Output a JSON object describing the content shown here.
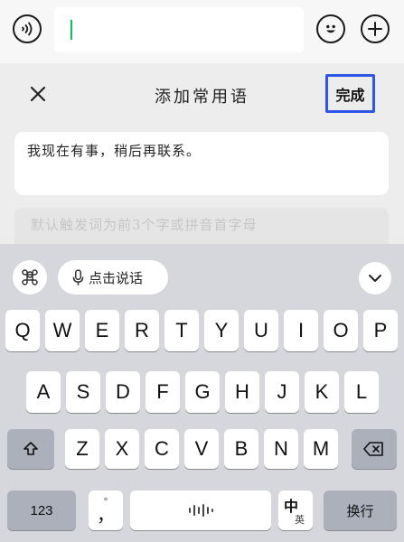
{
  "chat_input": {
    "value": ""
  },
  "panel": {
    "title": "添加常用语",
    "done_label": "完成",
    "phrase_text": "我现在有事，稍后再联系。",
    "hint_text": "默认触发词为前3个字或拼音首字母"
  },
  "keyboard": {
    "voice_label": "点击说话",
    "row1": [
      "Q",
      "W",
      "E",
      "R",
      "T",
      "Y",
      "U",
      "I",
      "O",
      "P"
    ],
    "row2": [
      "A",
      "S",
      "D",
      "F",
      "G",
      "H",
      "J",
      "K",
      "L"
    ],
    "row3": [
      "Z",
      "X",
      "C",
      "V",
      "B",
      "N",
      "M"
    ],
    "numbers_label": "123",
    "punct_top": "°",
    "punct_main": "，",
    "lang_main": "中",
    "lang_alt": "英",
    "return_label": "换行"
  },
  "icons": {
    "voice": "voice-wave-icon",
    "emoji": "smiley-icon",
    "plus": "plus-icon",
    "close": "close-icon",
    "grid": "command-icon",
    "mic": "microphone-icon",
    "collapse": "chevron-down-icon",
    "shift": "shift-icon",
    "delete": "backspace-icon",
    "space": "audio-wave-icon"
  },
  "colors": {
    "accent_green": "#07c160",
    "focus_border": "#2f55e6"
  }
}
